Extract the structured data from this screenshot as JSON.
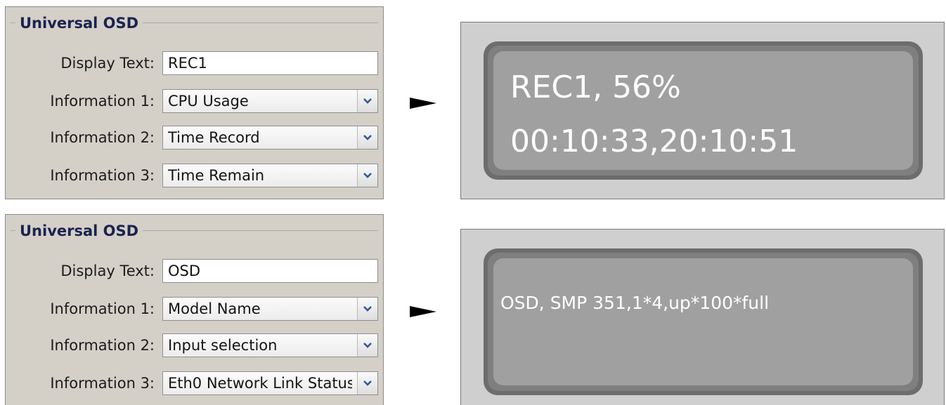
{
  "panels": [
    {
      "legend": "Universal OSD",
      "display_text_label": "Display Text:",
      "display_text_value": "REC1",
      "info1_label": "Information 1:",
      "info1_value": "CPU Usage",
      "info2_label": "Information 2:",
      "info2_value": "Time Record",
      "info3_label": "Information 3:",
      "info3_value": "Time Remain"
    },
    {
      "legend": "Universal OSD",
      "display_text_label": "Display Text:",
      "display_text_value": "OSD",
      "info1_label": "Information 1:",
      "info1_value": "Model Name",
      "info2_label": "Information 2:",
      "info2_value": "Input selection",
      "info3_label": "Information 3:",
      "info3_value": "Eth0 Network Link Status"
    }
  ],
  "osd_previews": [
    {
      "line1": "REC1,  56%",
      "line2": "00:10:33,20:10:51"
    },
    {
      "line1": "OSD, SMP 351,1*4,up*100*full"
    }
  ],
  "icons": {
    "dropdown": "chevron-down-icon",
    "arrow": "arrow-right-icon"
  },
  "colors": {
    "panel_bg": "#d4d0c8",
    "legend_text": "#1a2350",
    "chevron": "#2c5aa0",
    "screen_bg": "#a0a0a0",
    "screen_text": "#ffffff"
  }
}
